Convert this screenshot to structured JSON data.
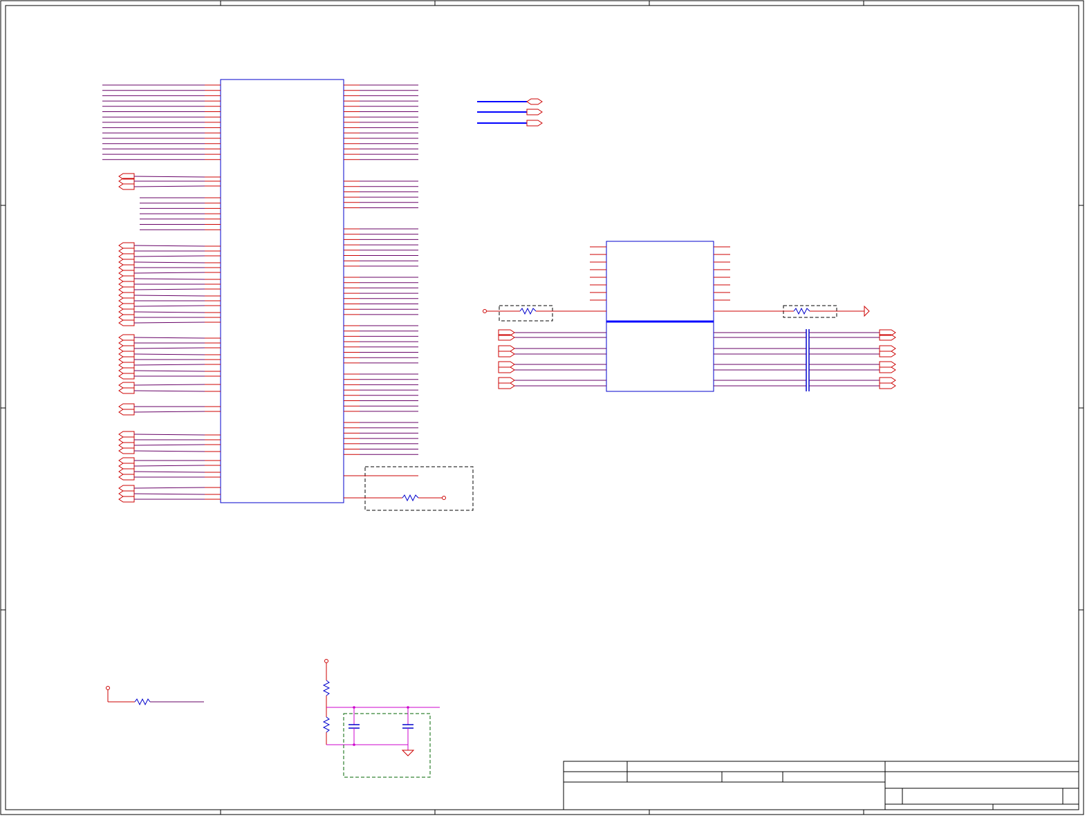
{
  "sheet": {
    "title": "",
    "zone_markers": []
  },
  "colors": {
    "frame": "#000000",
    "wire": "#cc0000",
    "net": "#660066",
    "part_outline": "#0000cc",
    "bus": "#0000ff",
    "group_box_black": "#000000",
    "group_box_green": "#006600",
    "cap_net": "#cc00cc"
  },
  "components": {
    "main_ic": {
      "kind": "ic-body"
    },
    "secondary_ic": {
      "kind": "ic-body"
    },
    "off_page_connectors": {
      "kind": "port-symbol"
    },
    "resistors": {
      "kind": "resistor-symbol"
    },
    "capacitors": {
      "kind": "capacitor-symbol"
    },
    "ground": {
      "kind": "ground-symbol"
    }
  },
  "title_block": {
    "cells": [
      "",
      "",
      "",
      "",
      "",
      "",
      "",
      ""
    ]
  }
}
